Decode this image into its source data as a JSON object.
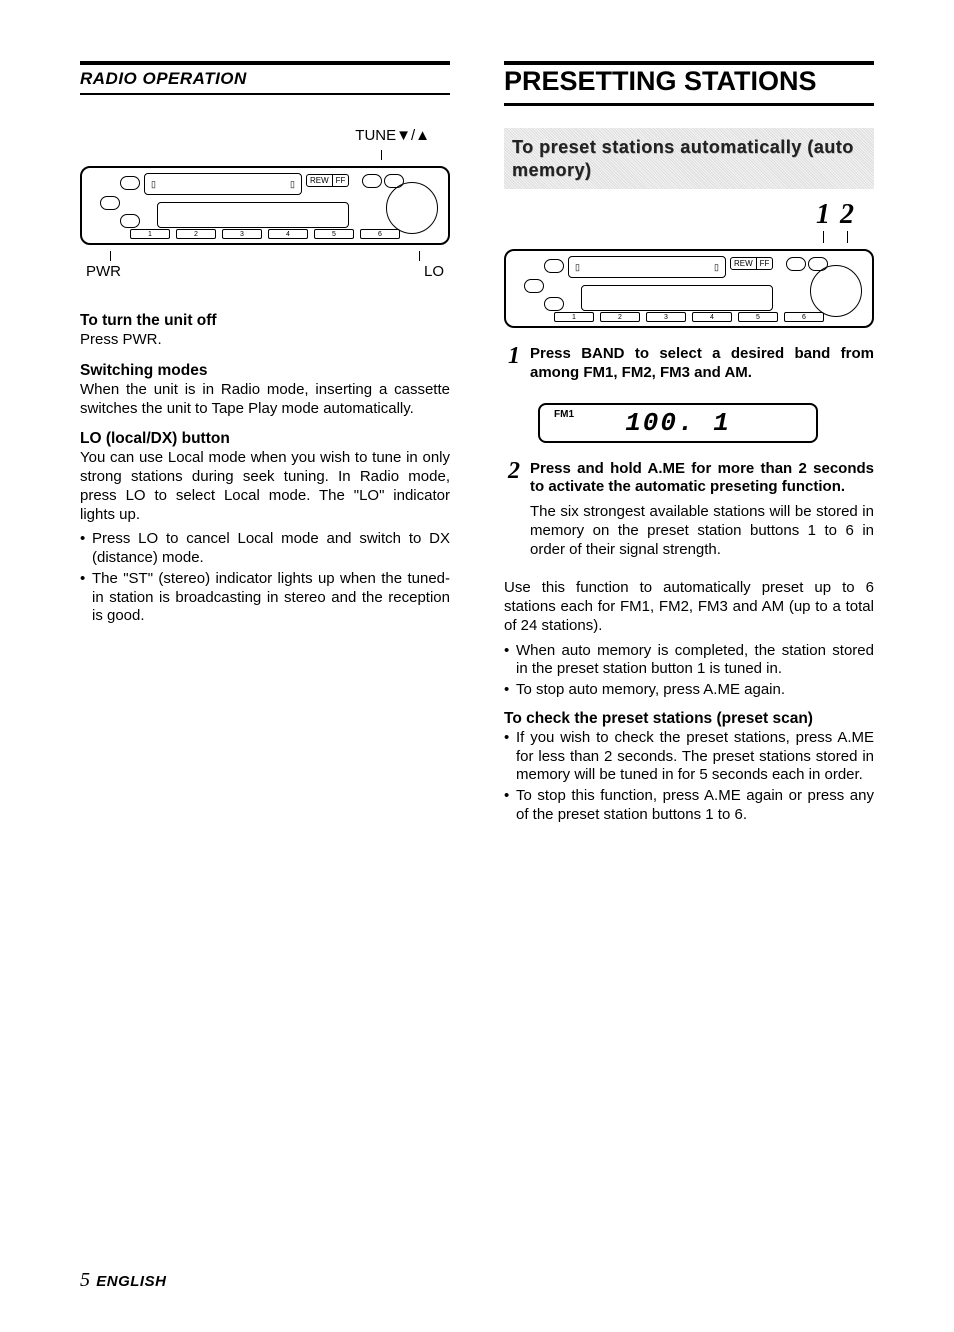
{
  "left": {
    "section_title": "RADIO OPERATION",
    "tune_label": "TUNE▼/▲",
    "pwr_label": "PWR",
    "lo_label": "LO",
    "blocks": [
      {
        "heading": "To turn the unit off",
        "paras": [
          "Press PWR."
        ]
      },
      {
        "heading": "Switching modes",
        "paras": [
          "When the unit is in Radio mode, inserting a cassette switches the unit to Tape Play mode automatically."
        ]
      },
      {
        "heading": "LO (local/DX) button",
        "paras": [
          "You can use Local mode when you wish to tune in only strong stations during seek tuning. In Radio mode, press LO to select Local mode. The \"LO\" indicator lights up."
        ],
        "bullets": [
          "Press LO to cancel Local mode and switch to DX (distance) mode.",
          "The \"ST\" (stereo) indicator lights up when the tuned-in station is broadcasting in stereo and the reception is good."
        ]
      }
    ]
  },
  "right": {
    "section_title": "PRESETTING STATIONS",
    "sub_title": "To preset stations automatically (auto memory)",
    "callout_1": "1",
    "callout_2": "2",
    "steps": [
      {
        "num": "1",
        "lead": "Press BAND to select a desired band from among FM1, FM2, FM3 and AM.",
        "display": {
          "band": "FM1",
          "freq": "100. 1"
        }
      },
      {
        "num": "2",
        "lead": "Press and hold A.ME for more than 2 seconds to activate the automatic preseting function.",
        "para": "The six strongest available stations will be stored in memory on the preset station buttons 1 to 6 in order of their signal strength."
      }
    ],
    "after_para": "Use this function to automatically preset up to 6 stations each for FM1, FM2, FM3 and AM (up to a total of 24 stations).",
    "after_bullets": [
      "When auto memory is completed, the station stored in the preset station button 1 is tuned in.",
      "To stop auto memory, press A.ME again."
    ],
    "check": {
      "heading": "To check the preset stations (preset scan)",
      "bullets": [
        "If you wish to check the preset stations, press A.ME for less than 2 seconds. The preset stations stored in memory will be tuned in for 5 seconds each in order.",
        "To stop this function, press A.ME again or press any of the preset station buttons 1 to 6."
      ]
    }
  },
  "footer": {
    "page": "5",
    "lang": "ENGLISH"
  },
  "device": {
    "rew": "REW",
    "ff": "FF",
    "presets": [
      "1",
      "2",
      "3",
      "4",
      "5",
      "6"
    ]
  }
}
